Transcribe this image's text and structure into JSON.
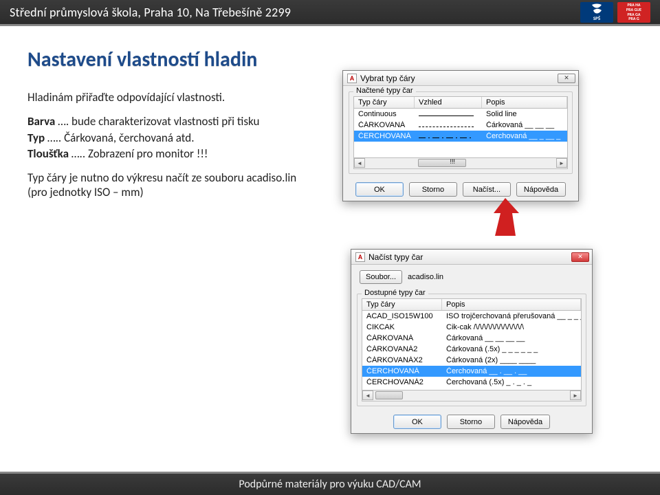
{
  "header": {
    "title": "Střední průmyslová škola, Praha 10, Na Třebešíně 2299",
    "logo1_text": "SPŠ",
    "logo2_text": "PRA HA\nPRA GUE\nPRA GA\nPRA G"
  },
  "footer": {
    "text": "Podpůrné materiály pro výuku CAD/CAM"
  },
  "slide": {
    "heading": "Nastavení vlastností hladin",
    "p1": "Hladinám přiřaďte odpovídající vlastnosti.",
    "p2a": "Barva",
    "p2b": " …. bude charakterizovat vlastnosti při tisku",
    "p3a": "Typ",
    "p3b": " ….. Čárkovaná, čerchovaná atd.",
    "p4a": "Tloušťka",
    "p4b": " ….. Zobrazení pro monitor !!!",
    "p5": "Typ čáry je nutno do výkresu načít ze souboru acadiso.lin (pro jednotky ISO – mm)"
  },
  "dlg1": {
    "title": "Vybrat typ čáry",
    "group": "Načtené typy čar",
    "cols": [
      "Typ čáry",
      "Vzhled",
      "Popis"
    ],
    "rows": [
      {
        "name": "Continuous",
        "sample": "solid",
        "desc": "Solid line"
      },
      {
        "name": "ČÁRKOVANÁ",
        "sample": "dash",
        "desc": "Čárkovaná __ __ __"
      },
      {
        "name": "ČERCHOVANÁ",
        "sample": "dd",
        "desc": "Čerchovaná __ _ __ _",
        "selected": true
      }
    ],
    "buttons": {
      "ok": "OK",
      "storno": "Storno",
      "nacist": "Načíst...",
      "napoveda": "Nápověda"
    },
    "scroll_label": "!!!"
  },
  "dlg2": {
    "title": "Načíst typy čar",
    "soubor_btn": "Soubor...",
    "soubor_val": "acadiso.lin",
    "group": "Dostupné typy čar",
    "cols": [
      "Typ čáry",
      "Popis"
    ],
    "rows": [
      {
        "name": "ACAD_ISO15W100",
        "desc": "ISO trojčerchovaná přerušovaná __ _ _ _",
        "sample": "dd"
      },
      {
        "name": "CIKCAK",
        "desc": "Cik-cak /\\/\\/\\/\\/\\/\\/\\/\\/\\/\\/\\/\\",
        "sample": "zig"
      },
      {
        "name": "ČÁRKOVANÁ",
        "desc": "Čárkovaná __ __ __ __",
        "sample": "dash"
      },
      {
        "name": "ČÁRKOVANÁ2",
        "desc": "Čárkovaná (.5x) _ _ _ _ _ _",
        "sample": "dash"
      },
      {
        "name": "ČÁRKOVANÁX2",
        "desc": "Čárkovaná (2x) ____  ____",
        "sample": "dash"
      },
      {
        "name": "ČERCHOVANÁ",
        "desc": "Čerchovaná __ . __ . __",
        "sample": "dd",
        "selected": true
      },
      {
        "name": "ČERCHOVANÁ2",
        "desc": "Čerchovaná (.5x) _ . _ . _",
        "sample": "dd"
      }
    ],
    "buttons": {
      "ok": "OK",
      "storno": "Storno",
      "napoveda": "Nápověda"
    }
  }
}
